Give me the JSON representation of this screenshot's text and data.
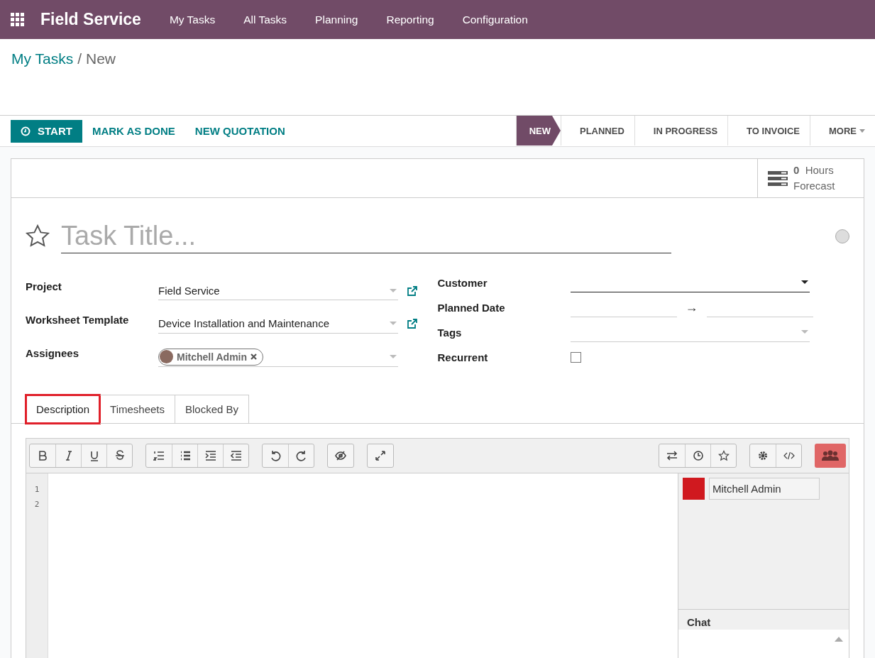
{
  "app": {
    "name": "Field Service",
    "menu": [
      "My Tasks",
      "All Tasks",
      "Planning",
      "Reporting",
      "Configuration"
    ]
  },
  "breadcrumb": [
    {
      "label": "My Tasks",
      "kind": "link"
    },
    {
      "label": "/",
      "kind": "separator"
    },
    {
      "label": "New",
      "kind": "current"
    }
  ],
  "actions": [
    {
      "label": "START",
      "kind": "primary"
    },
    {
      "label": "MARK AS DONE",
      "kind": "link"
    },
    {
      "label": "NEW QUOTATION",
      "kind": "link"
    }
  ],
  "stages": [
    {
      "label": "NEW",
      "selected": true
    },
    {
      "label": "PLANNED",
      "selected": false
    },
    {
      "label": "IN PROGRESS",
      "selected": false
    },
    {
      "label": "TO INVOICE",
      "selected": false
    },
    {
      "label": "MORE",
      "selected": false,
      "kind": "dropdown"
    }
  ],
  "stat_button": {
    "value": "0",
    "unit": "Hours",
    "label": "Forecast"
  },
  "title": {
    "placeholder": "Task Title...",
    "starred": false
  },
  "fields_left": [
    {
      "label": "Project",
      "kind": "many2one",
      "value": "Field Service",
      "external_link": true
    },
    {
      "label": "Worksheet Template",
      "kind": "many2one",
      "value": "Device Installation and Maintenance",
      "external_link": true
    },
    {
      "label": "Assignees",
      "kind": "tags",
      "value": "Mitchell Admin",
      "external_link": false
    }
  ],
  "fields_right": [
    {
      "label": "Customer",
      "kind": "select"
    },
    {
      "label": "Planned Date",
      "kind": "daterange",
      "separator": "→"
    },
    {
      "label": "Tags",
      "kind": "tags"
    },
    {
      "label": "Recurrent",
      "kind": "checkbox",
      "checked": false
    }
  ],
  "tabs": [
    {
      "label": "Description",
      "selected": true,
      "highlighted": true
    },
    {
      "label": "Timesheets",
      "selected": false,
      "highlighted": false
    },
    {
      "label": "Blocked By",
      "selected": false,
      "highlighted": false
    }
  ],
  "editor": {
    "line_numbers": [
      "1",
      "2"
    ],
    "collaborators": [
      {
        "name": "Mitchell Admin",
        "color": "#d0191f"
      }
    ],
    "chat_title": "Chat"
  }
}
